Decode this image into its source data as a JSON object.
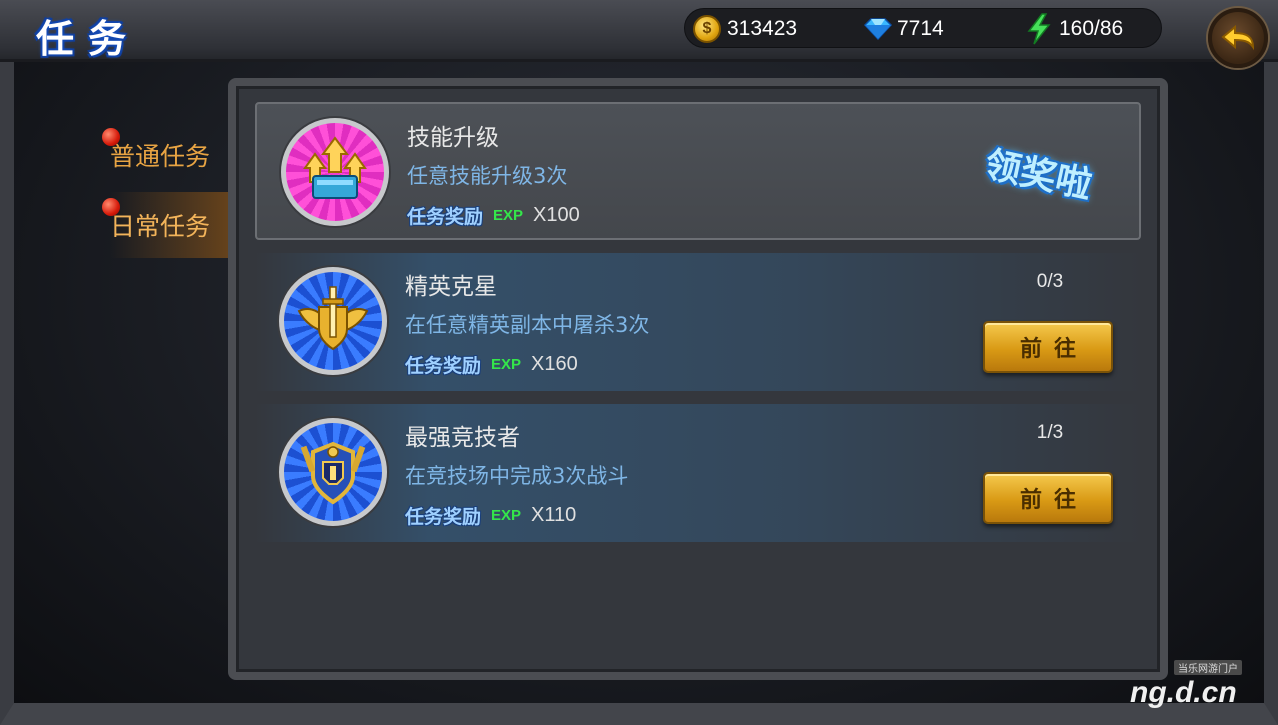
{
  "header": {
    "title": "任务",
    "gold": "313423",
    "diamonds": "7714",
    "energy": "160/86",
    "back_icon": "back-arrow-icon"
  },
  "tabs": [
    {
      "label": "普通任务",
      "active": false
    },
    {
      "label": "日常任务",
      "active": true
    }
  ],
  "tasks": [
    {
      "name": "技能升级",
      "desc": "任意技能升级3次",
      "reward_label": "任务奖励",
      "exp_label": "EXP",
      "reward_value": "X100",
      "claim_label": "领奖啦",
      "icon": "skill-upgrade-icon"
    },
    {
      "name": "精英克星",
      "desc": "在任意精英副本中屠杀3次",
      "reward_label": "任务奖励",
      "exp_label": "EXP",
      "reward_value": "X160",
      "progress": "0/3",
      "button_label": "前往",
      "icon": "elite-sword-icon"
    },
    {
      "name": "最强竞技者",
      "desc": "在竞技场中完成3次战斗",
      "reward_label": "任务奖励",
      "exp_label": "EXP",
      "reward_value": "X110",
      "progress": "1/3",
      "button_label": "前往",
      "icon": "arena-shield-icon"
    }
  ],
  "watermark": {
    "small": "当乐网游门户",
    "big": "ng.d.cn"
  }
}
